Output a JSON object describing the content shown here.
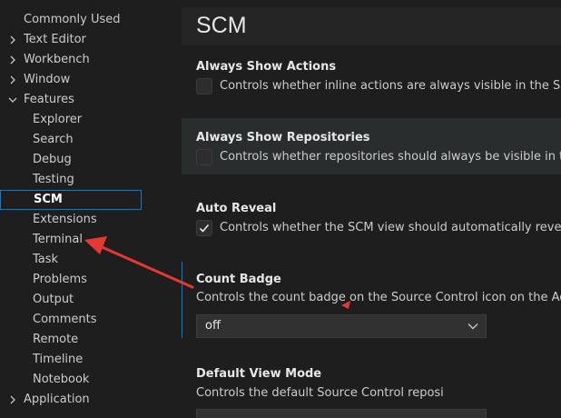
{
  "sidebar": {
    "items": [
      {
        "label": "Commonly Used"
      },
      {
        "label": "Text Editor"
      },
      {
        "label": "Workbench"
      },
      {
        "label": "Window"
      },
      {
        "label": "Features"
      },
      {
        "label": "Explorer"
      },
      {
        "label": "Search"
      },
      {
        "label": "Debug"
      },
      {
        "label": "Testing"
      },
      {
        "label": "SCM"
      },
      {
        "label": "Extensions"
      },
      {
        "label": "Terminal"
      },
      {
        "label": "Task"
      },
      {
        "label": "Problems"
      },
      {
        "label": "Output"
      },
      {
        "label": "Comments"
      },
      {
        "label": "Remote"
      },
      {
        "label": "Timeline"
      },
      {
        "label": "Notebook"
      },
      {
        "label": "Application"
      }
    ]
  },
  "main": {
    "section_title": "SCM",
    "settings": [
      {
        "title": "Always Show Actions",
        "description": "Controls whether inline actions are always visible in the Source Co",
        "checked": false
      },
      {
        "title": "Always Show Repositories",
        "description": "Controls whether repositories should always be visible in the SCM",
        "checked": false
      },
      {
        "title": "Auto Reveal",
        "description": "Controls whether the SCM view should automatically reveal and se",
        "checked": true
      },
      {
        "title": "Count Badge",
        "description": "Controls the count badge on the Source Control icon on the Activity Ba",
        "value": "off"
      },
      {
        "title": "Default View Mode",
        "description": "Controls the default Source Control reposi"
      }
    ]
  },
  "colors": {
    "background": "#1e1e1e",
    "focus_border": "#007fd4",
    "highlight_row": "#2a2d2e",
    "annotation_arrow": "#e53935"
  }
}
